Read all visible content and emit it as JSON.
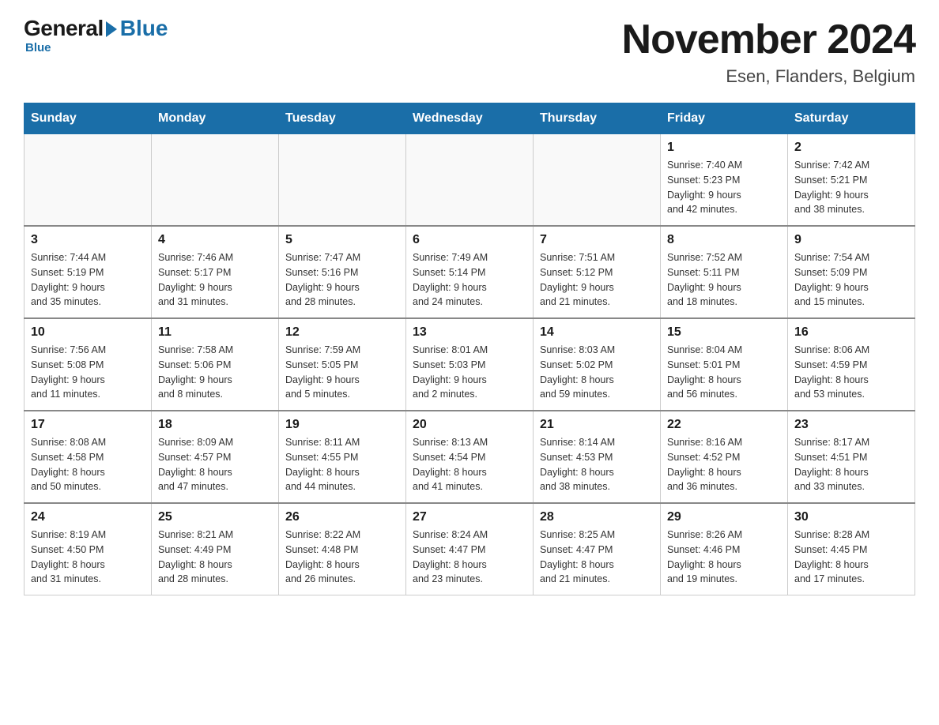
{
  "header": {
    "logo": {
      "general": "General",
      "blue": "Blue",
      "tagline": "Blue"
    },
    "title": "November 2024",
    "location": "Esen, Flanders, Belgium"
  },
  "days_of_week": [
    "Sunday",
    "Monday",
    "Tuesday",
    "Wednesday",
    "Thursday",
    "Friday",
    "Saturday"
  ],
  "weeks": [
    {
      "days": [
        {
          "num": "",
          "info": ""
        },
        {
          "num": "",
          "info": ""
        },
        {
          "num": "",
          "info": ""
        },
        {
          "num": "",
          "info": ""
        },
        {
          "num": "",
          "info": ""
        },
        {
          "num": "1",
          "info": "Sunrise: 7:40 AM\nSunset: 5:23 PM\nDaylight: 9 hours\nand 42 minutes."
        },
        {
          "num": "2",
          "info": "Sunrise: 7:42 AM\nSunset: 5:21 PM\nDaylight: 9 hours\nand 38 minutes."
        }
      ]
    },
    {
      "days": [
        {
          "num": "3",
          "info": "Sunrise: 7:44 AM\nSunset: 5:19 PM\nDaylight: 9 hours\nand 35 minutes."
        },
        {
          "num": "4",
          "info": "Sunrise: 7:46 AM\nSunset: 5:17 PM\nDaylight: 9 hours\nand 31 minutes."
        },
        {
          "num": "5",
          "info": "Sunrise: 7:47 AM\nSunset: 5:16 PM\nDaylight: 9 hours\nand 28 minutes."
        },
        {
          "num": "6",
          "info": "Sunrise: 7:49 AM\nSunset: 5:14 PM\nDaylight: 9 hours\nand 24 minutes."
        },
        {
          "num": "7",
          "info": "Sunrise: 7:51 AM\nSunset: 5:12 PM\nDaylight: 9 hours\nand 21 minutes."
        },
        {
          "num": "8",
          "info": "Sunrise: 7:52 AM\nSunset: 5:11 PM\nDaylight: 9 hours\nand 18 minutes."
        },
        {
          "num": "9",
          "info": "Sunrise: 7:54 AM\nSunset: 5:09 PM\nDaylight: 9 hours\nand 15 minutes."
        }
      ]
    },
    {
      "days": [
        {
          "num": "10",
          "info": "Sunrise: 7:56 AM\nSunset: 5:08 PM\nDaylight: 9 hours\nand 11 minutes."
        },
        {
          "num": "11",
          "info": "Sunrise: 7:58 AM\nSunset: 5:06 PM\nDaylight: 9 hours\nand 8 minutes."
        },
        {
          "num": "12",
          "info": "Sunrise: 7:59 AM\nSunset: 5:05 PM\nDaylight: 9 hours\nand 5 minutes."
        },
        {
          "num": "13",
          "info": "Sunrise: 8:01 AM\nSunset: 5:03 PM\nDaylight: 9 hours\nand 2 minutes."
        },
        {
          "num": "14",
          "info": "Sunrise: 8:03 AM\nSunset: 5:02 PM\nDaylight: 8 hours\nand 59 minutes."
        },
        {
          "num": "15",
          "info": "Sunrise: 8:04 AM\nSunset: 5:01 PM\nDaylight: 8 hours\nand 56 minutes."
        },
        {
          "num": "16",
          "info": "Sunrise: 8:06 AM\nSunset: 4:59 PM\nDaylight: 8 hours\nand 53 minutes."
        }
      ]
    },
    {
      "days": [
        {
          "num": "17",
          "info": "Sunrise: 8:08 AM\nSunset: 4:58 PM\nDaylight: 8 hours\nand 50 minutes."
        },
        {
          "num": "18",
          "info": "Sunrise: 8:09 AM\nSunset: 4:57 PM\nDaylight: 8 hours\nand 47 minutes."
        },
        {
          "num": "19",
          "info": "Sunrise: 8:11 AM\nSunset: 4:55 PM\nDaylight: 8 hours\nand 44 minutes."
        },
        {
          "num": "20",
          "info": "Sunrise: 8:13 AM\nSunset: 4:54 PM\nDaylight: 8 hours\nand 41 minutes."
        },
        {
          "num": "21",
          "info": "Sunrise: 8:14 AM\nSunset: 4:53 PM\nDaylight: 8 hours\nand 38 minutes."
        },
        {
          "num": "22",
          "info": "Sunrise: 8:16 AM\nSunset: 4:52 PM\nDaylight: 8 hours\nand 36 minutes."
        },
        {
          "num": "23",
          "info": "Sunrise: 8:17 AM\nSunset: 4:51 PM\nDaylight: 8 hours\nand 33 minutes."
        }
      ]
    },
    {
      "days": [
        {
          "num": "24",
          "info": "Sunrise: 8:19 AM\nSunset: 4:50 PM\nDaylight: 8 hours\nand 31 minutes."
        },
        {
          "num": "25",
          "info": "Sunrise: 8:21 AM\nSunset: 4:49 PM\nDaylight: 8 hours\nand 28 minutes."
        },
        {
          "num": "26",
          "info": "Sunrise: 8:22 AM\nSunset: 4:48 PM\nDaylight: 8 hours\nand 26 minutes."
        },
        {
          "num": "27",
          "info": "Sunrise: 8:24 AM\nSunset: 4:47 PM\nDaylight: 8 hours\nand 23 minutes."
        },
        {
          "num": "28",
          "info": "Sunrise: 8:25 AM\nSunset: 4:47 PM\nDaylight: 8 hours\nand 21 minutes."
        },
        {
          "num": "29",
          "info": "Sunrise: 8:26 AM\nSunset: 4:46 PM\nDaylight: 8 hours\nand 19 minutes."
        },
        {
          "num": "30",
          "info": "Sunrise: 8:28 AM\nSunset: 4:45 PM\nDaylight: 8 hours\nand 17 minutes."
        }
      ]
    }
  ]
}
